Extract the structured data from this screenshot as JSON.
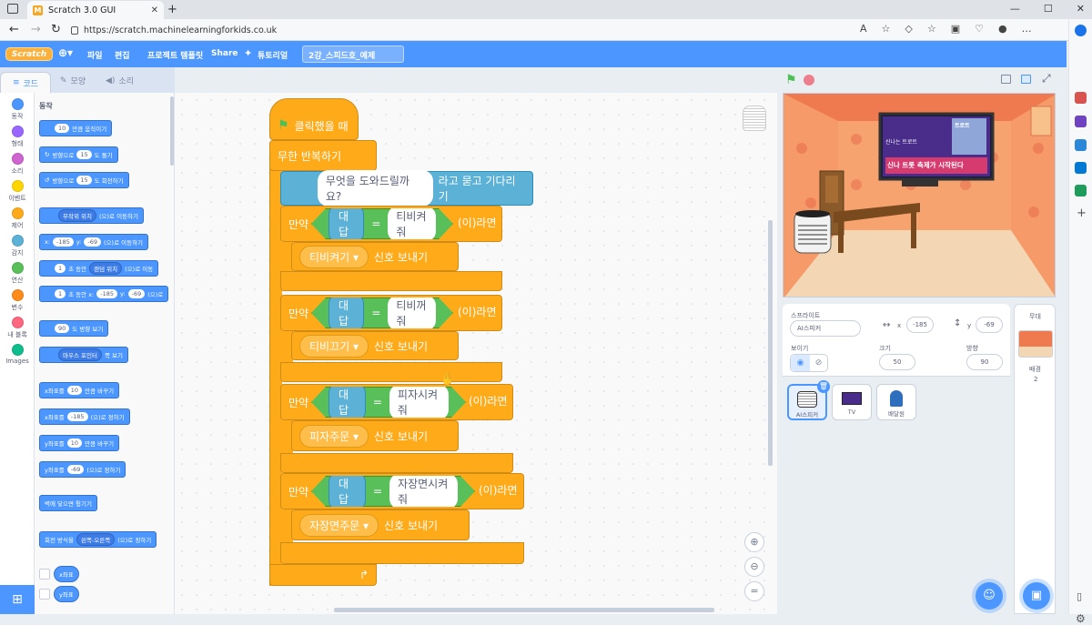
{
  "browser": {
    "tab_title": "Scratch 3.0 GUI",
    "url": "https://scratch.machinelearningforkids.co.uk"
  },
  "menu": {
    "items": [
      "파일",
      "편집",
      "프로젝트 템플릿",
      "Share",
      "튜토리얼"
    ],
    "project_title": "2강_스피드호_예제"
  },
  "editor_tabs": [
    "코드",
    "모양",
    "소리"
  ],
  "categories": [
    {
      "label": "동작",
      "color": "#4c97ff"
    },
    {
      "label": "형태",
      "color": "#9966ff"
    },
    {
      "label": "소리",
      "color": "#cf63cf"
    },
    {
      "label": "이벤트",
      "color": "#ffd500"
    },
    {
      "label": "제어",
      "color": "#ffab19"
    },
    {
      "label": "감지",
      "color": "#5cb1d6"
    },
    {
      "label": "연산",
      "color": "#59c059"
    },
    {
      "label": "변수",
      "color": "#ff8c1a"
    },
    {
      "label": "내 블록",
      "color": "#ff6680"
    },
    {
      "label": "Images",
      "color": "#0fbd8c"
    }
  ],
  "palette": {
    "section": "동작",
    "move": {
      "val": "10",
      "txt": "만큼 움직이기"
    },
    "turn_right": {
      "pre": "방향으로",
      "val": "15",
      "txt": "도 돌기"
    },
    "turn_left": {
      "pre": "방향으로",
      "val": "15",
      "txt": "도 회전하기"
    },
    "goto": {
      "dd": "무작위 위치",
      "txt": "(으)로 이동하기"
    },
    "goto_xy": {
      "x_label": "x:",
      "x": "-185",
      "y_label": "y:",
      "y": "-69",
      "txt": "(으)로 이동하기"
    },
    "glide_random": {
      "val": "1",
      "txt1": "초 동안",
      "dd": "랜덤 위치",
      "txt2": "(으)로 이동"
    },
    "glide_xy": {
      "val": "1",
      "txt1": "초 동안 x:",
      "x": "-185",
      "y_label": "y:",
      "y": "-69",
      "txt2": "(으)로"
    },
    "point_dir": {
      "val": "90",
      "txt": "도 방향 보기"
    },
    "point_towards": {
      "dd": "마우스 포인터",
      "txt": "쪽 보기"
    },
    "change_x": {
      "pre": "x좌표를",
      "val": "10",
      "txt": "만큼 바꾸기"
    },
    "set_x": {
      "pre": "x좌표를",
      "val": "-185",
      "txt": "(으)로 정하기"
    },
    "change_y": {
      "pre": "y좌표를",
      "val": "10",
      "txt": "만큼 바꾸기"
    },
    "set_y": {
      "pre": "y좌표를",
      "val": "-69",
      "txt": "(으)로 정하기"
    },
    "bounce": "벽에 닿으면 튕기기",
    "rotation": {
      "pre": "회전 방식을",
      "dd": "왼쪽-오른쪽",
      "txt": "(으)로 정하기"
    },
    "rep_x": "x좌표",
    "rep_y": "y좌표"
  },
  "script": {
    "hat": "클릭했을 때",
    "forever": "무한 반복하기",
    "ask": {
      "question": "무엇을 도와드릴까요?",
      "txt": "라고 묻고 기다리기"
    },
    "if_label": "만약",
    "then_label": "(이)라면",
    "answer": "대답",
    "eq": "=",
    "broadcast_txt": "신호 보내기",
    "conditions": [
      {
        "value": "티비켜줘",
        "message": "티비켜기"
      },
      {
        "value": "티비꺼줘",
        "message": "티비끄기"
      },
      {
        "value": "피자시켜줘",
        "message": "피자주문"
      },
      {
        "value": "자장면시켜줘",
        "message": "자장면주문"
      }
    ]
  },
  "stage": {
    "tv_top": "신나는 트로트",
    "tv_bottom": "신나 트롯 축제가 시작된다",
    "tv_logo": "트로트"
  },
  "sprite_info": {
    "sprite_label": "스프라이트",
    "name": "AI스피커",
    "x_label": "x",
    "x": "-185",
    "y_label": "y",
    "y": "-69",
    "show_label": "보이기",
    "size_label": "크기",
    "size": "50",
    "direction_label": "방향",
    "direction": "90"
  },
  "sprites": [
    "AI스피커",
    "TV",
    "배달원"
  ],
  "stage_pane": {
    "label": "무대",
    "backdrop_label": "배경",
    "backdrop_count": "2"
  }
}
